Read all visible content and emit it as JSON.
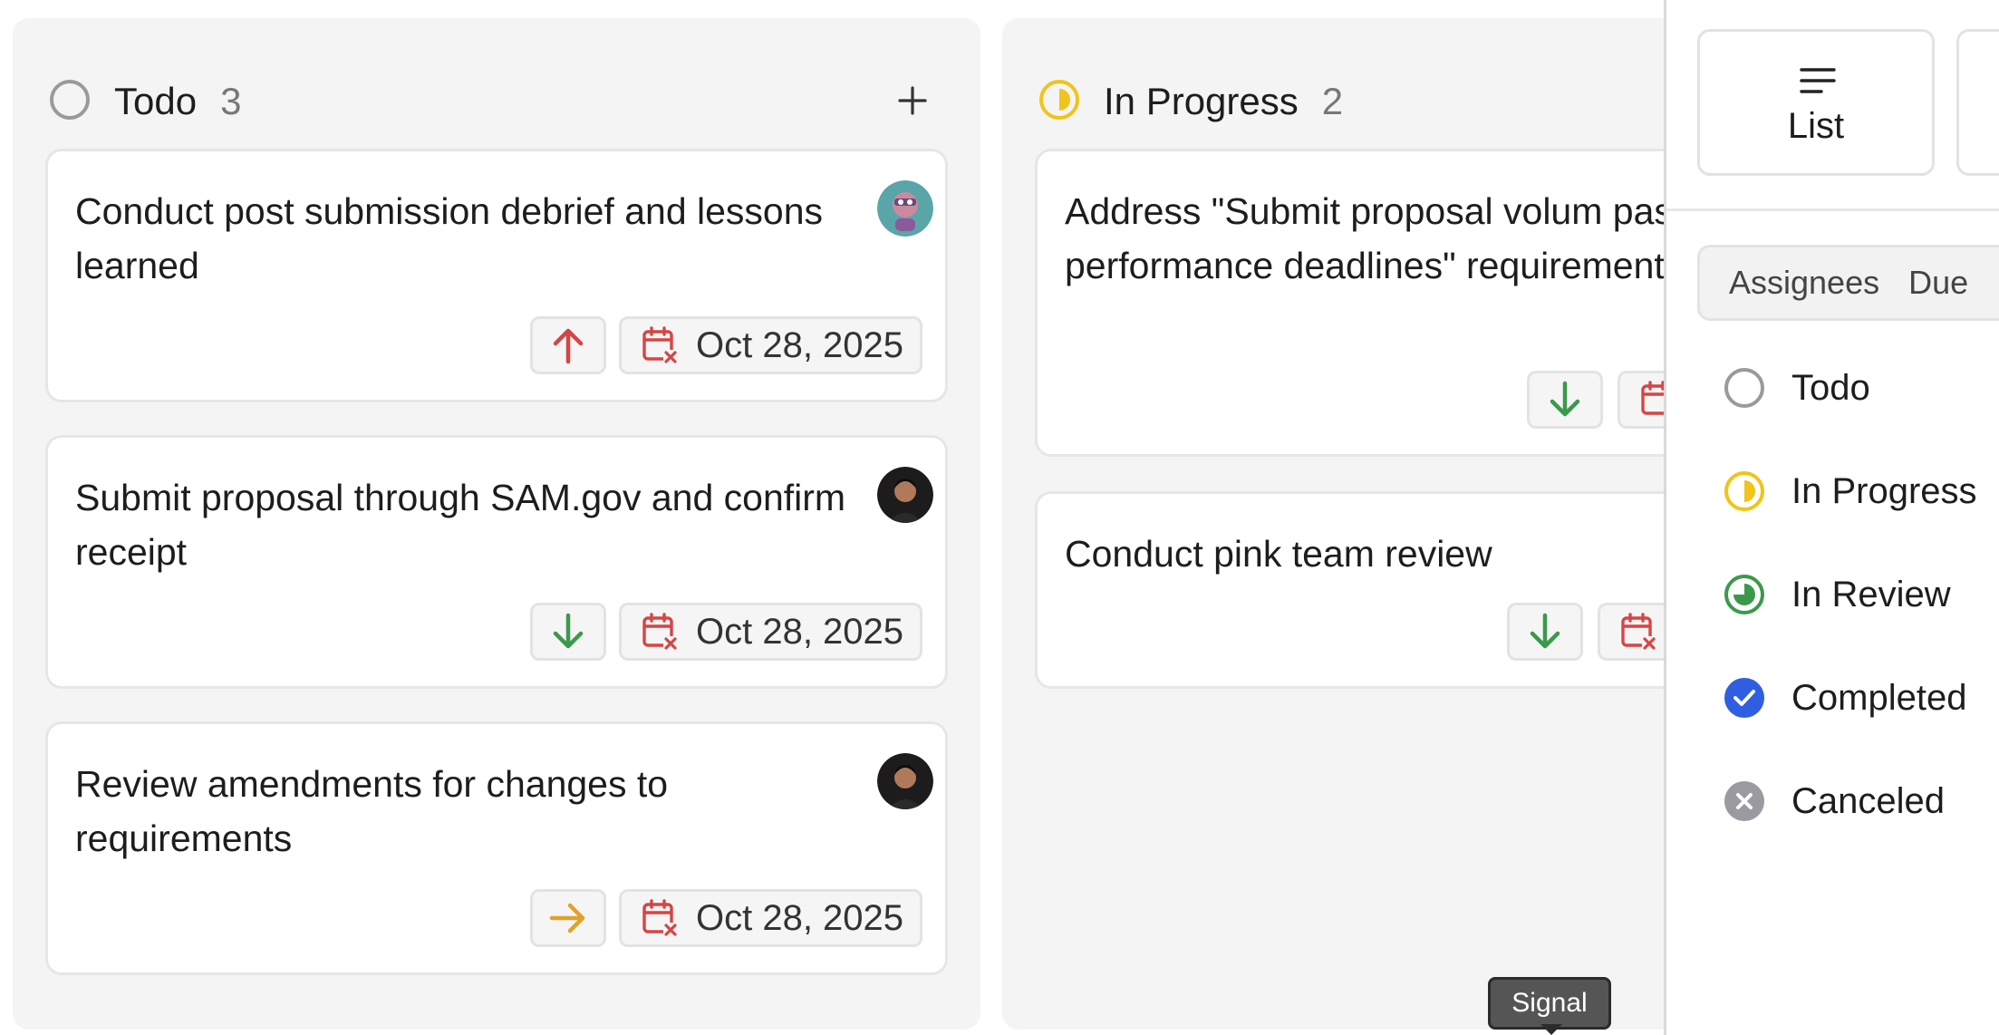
{
  "columns": {
    "todo": {
      "title": "Todo",
      "count": "3",
      "add_label": "+",
      "cards": [
        {
          "title": "Conduct post submission debrief and lessons learned",
          "priority": "high",
          "due": "Oct 28, 2025"
        },
        {
          "title": "Submit proposal through SAM.gov and confirm receipt",
          "priority": "low",
          "due": "Oct 28, 2025"
        },
        {
          "title": "Review amendments for changes to requirements",
          "priority": "medium",
          "due": "Oct 28, 2025"
        }
      ]
    },
    "in_progress": {
      "title": "In Progress",
      "count": "2",
      "cards": [
        {
          "title": "Address \"Submit proposal volum past-performance deadlines\" requirement",
          "priority": "low"
        },
        {
          "title": "Conduct pink team review",
          "priority": "low"
        }
      ]
    }
  },
  "panel": {
    "view_buttons": [
      {
        "label": "List",
        "icon": "list-icon"
      }
    ],
    "tabs": [
      "Assignees",
      "Due"
    ],
    "statuses": [
      {
        "label": "Todo",
        "icon": "status-todo-icon"
      },
      {
        "label": "In Progress",
        "icon": "status-in-progress-icon"
      },
      {
        "label": "In Review",
        "icon": "status-in-review-icon"
      },
      {
        "label": "Completed",
        "icon": "status-completed-icon"
      },
      {
        "label": "Canceled",
        "icon": "status-canceled-icon"
      }
    ]
  },
  "tooltip": {
    "text": "Signal"
  },
  "colors": {
    "priority_high": "#d64545",
    "priority_low": "#3a9a4a",
    "priority_medium": "#e0a22a",
    "due_overdue": "#d64545",
    "in_progress": "#f0c419",
    "in_review": "#3a9a4a",
    "completed": "#2f5fe0",
    "canceled": "#9a9aa0"
  }
}
